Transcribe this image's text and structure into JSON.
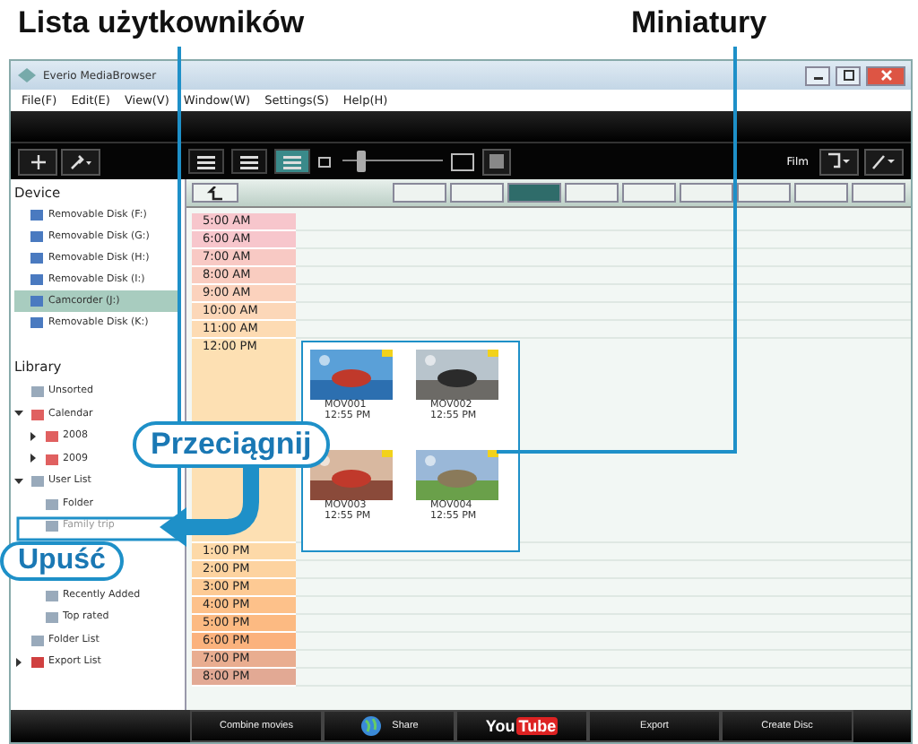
{
  "callouts": {
    "user_list": "Lista użytkowników",
    "thumbnails": "Miniatury",
    "drag": "Przeciągnij",
    "drop": "Upuść"
  },
  "window": {
    "title": "Everio MediaBrowser"
  },
  "menu": [
    "File(F)",
    "Edit(E)",
    "View(V)",
    "Window(W)",
    "Settings(S)",
    "Help(H)"
  ],
  "toolbar": {
    "views": [
      {
        "selected": false
      },
      {
        "selected": false
      },
      {
        "selected": true
      }
    ],
    "zoom": {
      "level": 0.15
    },
    "filter_label": "Film"
  },
  "sidebar": {
    "device_heading": "Device",
    "devices": [
      {
        "label": "Removable Disk (F:)",
        "selected": false
      },
      {
        "label": "Removable Disk (G:)",
        "selected": false
      },
      {
        "label": "Removable Disk (H:)",
        "selected": false
      },
      {
        "label": "Removable Disk (I:)",
        "selected": false
      },
      {
        "label": "Camcorder (J:)",
        "selected": true
      },
      {
        "label": "Removable Disk (K:)",
        "selected": false
      }
    ],
    "library_heading": "Library",
    "library": [
      {
        "label": "Unsorted",
        "kind": "unsorted"
      },
      {
        "label": "Calendar",
        "kind": "calendar",
        "expanded": true,
        "children": [
          {
            "label": "2008",
            "kind": "calendar",
            "expanded": false
          },
          {
            "label": "2009",
            "kind": "calendar",
            "expanded": false
          }
        ]
      },
      {
        "label": "User List",
        "kind": "folder",
        "expanded": true,
        "children": [
          {
            "label": "Folder",
            "kind": "user"
          },
          {
            "label": "Family trip",
            "kind": "user",
            "dropped": true
          },
          {
            "label": "Recently Added",
            "kind": "user"
          },
          {
            "label": "Top rated",
            "kind": "user"
          }
        ]
      },
      {
        "label": "Folder List",
        "kind": "folderlist"
      },
      {
        "label": "Export List",
        "kind": "export",
        "expanded": false
      }
    ]
  },
  "calendar_nav": [
    {
      "selected": false
    },
    {
      "selected": false
    },
    {
      "selected": true
    },
    {
      "selected": false
    },
    {
      "selected": false
    },
    {
      "selected": false
    },
    {
      "selected": false
    },
    {
      "selected": false
    },
    {
      "selected": false
    }
  ],
  "times": [
    {
      "label": "5:00 AM",
      "color": "#f7c6cc"
    },
    {
      "label": "6:00 AM",
      "color": "#f7c6cc"
    },
    {
      "label": "7:00 AM",
      "color": "#f8c9c4"
    },
    {
      "label": "8:00 AM",
      "color": "#f9ccc0"
    },
    {
      "label": "9:00 AM",
      "color": "#fbd2bd"
    },
    {
      "label": "10:00 AM",
      "color": "#fcd7b8"
    },
    {
      "label": "11:00 AM",
      "color": "#fddbb3"
    },
    {
      "label": "12:00 PM",
      "color": "#fde0b3",
      "thumbnails": [
        {
          "name": "MOV001",
          "time": "12:55 PM"
        },
        {
          "name": "MOV002",
          "time": "12:55 PM"
        },
        {
          "name": "MOV003",
          "time": "12:55 PM"
        },
        {
          "name": "MOV004",
          "time": "12:55 PM"
        }
      ]
    },
    {
      "label": "1:00 PM",
      "color": "#fdd9a8"
    },
    {
      "label": "2:00 PM",
      "color": "#fdd3a0"
    },
    {
      "label": "3:00 PM",
      "color": "#fdca94"
    },
    {
      "label": "4:00 PM",
      "color": "#fdc18a"
    },
    {
      "label": "5:00 PM",
      "color": "#fcba82"
    },
    {
      "label": "6:00 PM",
      "color": "#fbb27d"
    },
    {
      "label": "7:00 PM",
      "color": "#e9ad90"
    },
    {
      "label": "8:00 PM",
      "color": "#e2a994"
    }
  ],
  "bottom_buttons": [
    {
      "label": "Combine movies",
      "kind": "text"
    },
    {
      "label": "Share",
      "kind": "globe"
    },
    {
      "label": "You",
      "label2": "Tube",
      "kind": "youtube"
    },
    {
      "label": "Export",
      "kind": "text"
    },
    {
      "label": "Create Disc",
      "kind": "text"
    }
  ]
}
